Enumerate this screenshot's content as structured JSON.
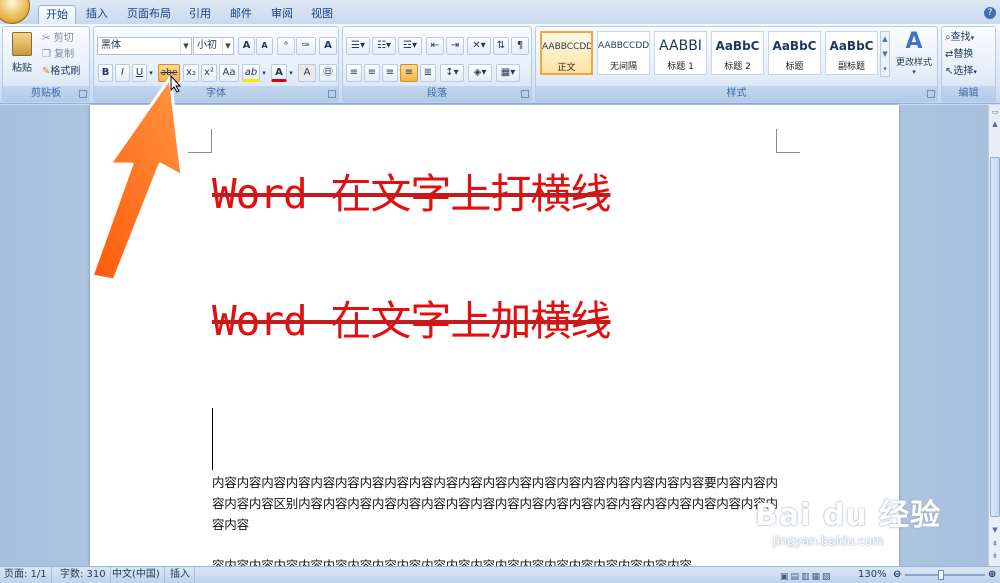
{
  "tabs": [
    "开始",
    "插入",
    "页面布局",
    "引用",
    "邮件",
    "审阅",
    "视图"
  ],
  "help_icon": "?",
  "clipboard": {
    "label": "剪贴板",
    "paste": "粘贴",
    "cut": "剪切",
    "copy": "复制",
    "format_painter": "格式刷"
  },
  "font": {
    "label": "字体",
    "font_name": "黑体",
    "font_size": "小初",
    "bold": "B",
    "italic": "I",
    "underline": "U",
    "strikethrough": "abe",
    "subscript": "x₂",
    "superscript": "x²",
    "change_case": "Aa",
    "grow": "A",
    "shrink": "A",
    "highlight": "ab",
    "font_color": "A"
  },
  "paragraph": {
    "label": "段落"
  },
  "styles": {
    "label": "样式",
    "items": [
      {
        "sample": "AABBCCDD",
        "name": "正文"
      },
      {
        "sample": "AABBCCDD",
        "name": "无间隔"
      },
      {
        "sample": "AABBI",
        "name": "标题 1"
      },
      {
        "sample": "AaBbC",
        "name": "标题 2"
      },
      {
        "sample": "AaBbC",
        "name": "标题"
      },
      {
        "sample": "AaBbC",
        "name": "副标题"
      }
    ],
    "change_styles": "更改样式"
  },
  "editing": {
    "label": "编辑",
    "find": "查找",
    "replace": "替换",
    "select": "选择"
  },
  "document": {
    "heading1": "Word 在文字上打横线",
    "heading2": "Word 在文字上加横线",
    "para1": "内容内容内容内容内容内容内容内容内容内容内容内容内容内容内容内容内容内容内容内容要内容内容内容内容内容区别内容内容内容内容内容内容内容内容内容内容内容内容内容内容内容内容内容内容内容内容内容",
    "para2": "容内容内容内容内容内容内容内容内容内容内容内容内容内容内容内容内容内容内容内容"
  },
  "status": {
    "page": "页面: 1/1",
    "words": "字数: 310",
    "language": "中文(中国)",
    "mode": "插入",
    "zoom": "130%"
  },
  "watermark": {
    "brand": "Bai du 经验",
    "url": "jingyan.baidu.com"
  },
  "colors": {
    "heading": "#e01010",
    "accent_arrow": "#ff6a1a",
    "ribbon": "#dbe7f6"
  }
}
